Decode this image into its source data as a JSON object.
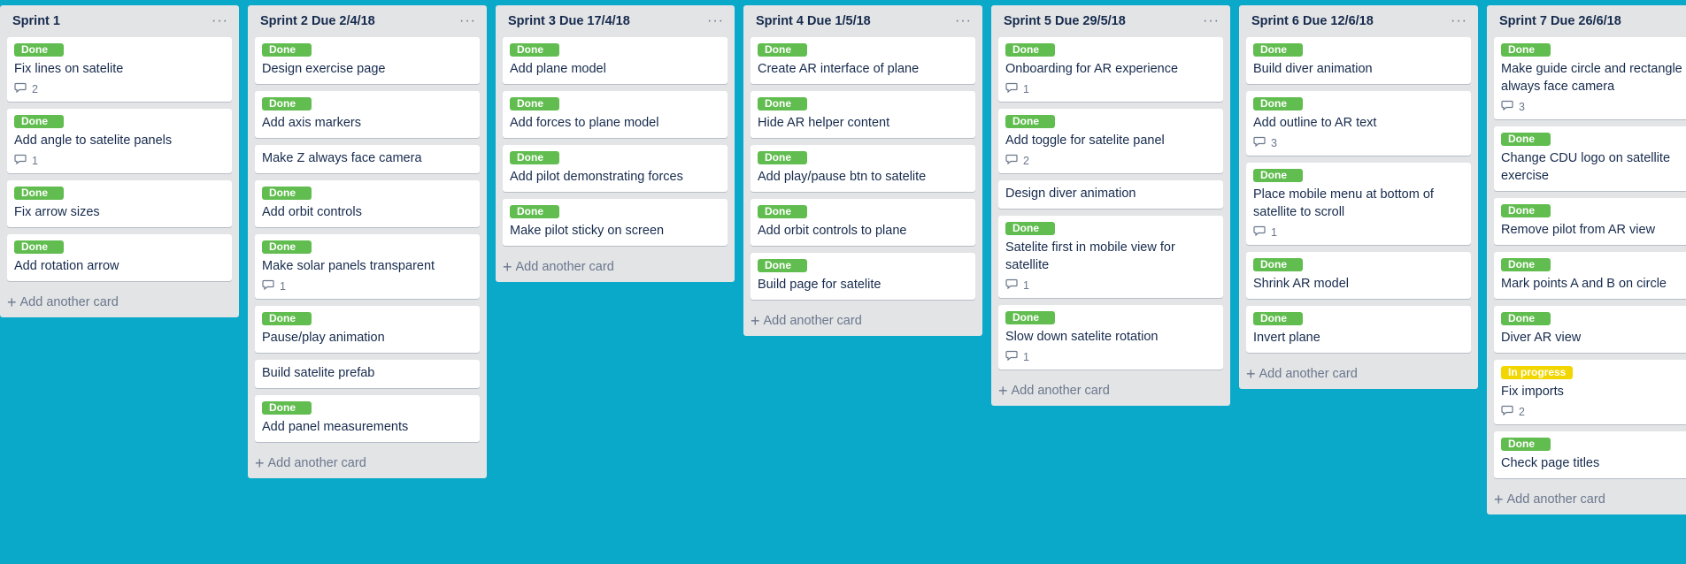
{
  "board": {
    "lists": [
      {
        "title": "Sprint 1",
        "add_label": "Add another card",
        "cards": [
          {
            "label": "Done",
            "label_type": "done",
            "title": "Fix lines on satelite",
            "comments": "2"
          },
          {
            "label": "Done",
            "label_type": "done",
            "title": "Add angle to satelite panels",
            "comments": "1"
          },
          {
            "label": "Done",
            "label_type": "done",
            "title": "Fix arrow sizes"
          },
          {
            "label": "Done",
            "label_type": "done",
            "title": "Add rotation arrow"
          }
        ]
      },
      {
        "title": "Sprint 2 Due 2/4/18",
        "add_label": "Add another card",
        "cards": [
          {
            "label": "Done",
            "label_type": "done",
            "title": "Design exercise page"
          },
          {
            "label": "Done",
            "label_type": "done",
            "title": "Add axis markers"
          },
          {
            "title": "Make Z always face camera"
          },
          {
            "label": "Done",
            "label_type": "done",
            "title": "Add orbit controls"
          },
          {
            "label": "Done",
            "label_type": "done",
            "title": "Make solar panels transparent",
            "comments": "1"
          },
          {
            "label": "Done",
            "label_type": "done",
            "title": "Pause/play animation"
          },
          {
            "title": "Build satelite prefab"
          },
          {
            "label": "Done",
            "label_type": "done",
            "title": "Add panel measurements"
          }
        ]
      },
      {
        "title": "Sprint 3 Due 17/4/18",
        "add_label": "Add another card",
        "cards": [
          {
            "label": "Done",
            "label_type": "done",
            "title": "Add plane model"
          },
          {
            "label": "Done",
            "label_type": "done",
            "title": "Add forces to plane model"
          },
          {
            "label": "Done",
            "label_type": "done",
            "title": "Add pilot demonstrating forces"
          },
          {
            "label": "Done",
            "label_type": "done",
            "title": "Make pilot sticky on screen"
          }
        ]
      },
      {
        "title": "Sprint 4 Due 1/5/18",
        "add_label": "Add another card",
        "cards": [
          {
            "label": "Done",
            "label_type": "done",
            "title": "Create AR interface of plane"
          },
          {
            "label": "Done",
            "label_type": "done",
            "title": "Hide AR helper content"
          },
          {
            "label": "Done",
            "label_type": "done",
            "title": "Add play/pause btn to satelite"
          },
          {
            "label": "Done",
            "label_type": "done",
            "title": "Add orbit controls to plane"
          },
          {
            "label": "Done",
            "label_type": "done",
            "title": "Build page for satelite"
          }
        ]
      },
      {
        "title": "Sprint 5 Due 29/5/18",
        "add_label": "Add another card",
        "cards": [
          {
            "label": "Done",
            "label_type": "done",
            "title": "Onboarding for AR experience",
            "comments": "1"
          },
          {
            "label": "Done",
            "label_type": "done",
            "title": "Add toggle for satelite panel",
            "comments": "2"
          },
          {
            "title": "Design diver animation"
          },
          {
            "label": "Done",
            "label_type": "done",
            "title": "Satelite first in mobile view for satellite",
            "comments": "1"
          },
          {
            "label": "Done",
            "label_type": "done",
            "title": "Slow down satelite rotation",
            "comments": "1"
          }
        ]
      },
      {
        "title": "Sprint 6 Due 12/6/18",
        "add_label": "Add another card",
        "cards": [
          {
            "label": "Done",
            "label_type": "done",
            "title": "Build diver animation"
          },
          {
            "label": "Done",
            "label_type": "done",
            "title": "Add outline to AR text",
            "comments": "3"
          },
          {
            "label": "Done",
            "label_type": "done",
            "title": "Place mobile menu at bottom of satellite to scroll",
            "comments": "1"
          },
          {
            "label": "Done",
            "label_type": "done",
            "title": "Shrink AR model"
          },
          {
            "label": "Done",
            "label_type": "done",
            "title": "Invert plane"
          }
        ]
      },
      {
        "title": "Sprint 7 Due 26/6/18",
        "add_label": "Add another card",
        "cards": [
          {
            "label": "Done",
            "label_type": "done",
            "title": "Make guide circle and rectangle always face camera",
            "comments": "3"
          },
          {
            "label": "Done",
            "label_type": "done",
            "title": "Change CDU logo on satellite exercise"
          },
          {
            "label": "Done",
            "label_type": "done",
            "title": "Remove pilot from AR view"
          },
          {
            "label": "Done",
            "label_type": "done",
            "title": "Mark points A and B on circle"
          },
          {
            "label": "Done",
            "label_type": "done",
            "title": "Diver AR view"
          },
          {
            "label": "In progress",
            "label_type": "progress",
            "title": "Fix imports",
            "comments": "2"
          },
          {
            "label": "Done",
            "label_type": "done",
            "title": "Check page titles"
          }
        ]
      }
    ]
  }
}
